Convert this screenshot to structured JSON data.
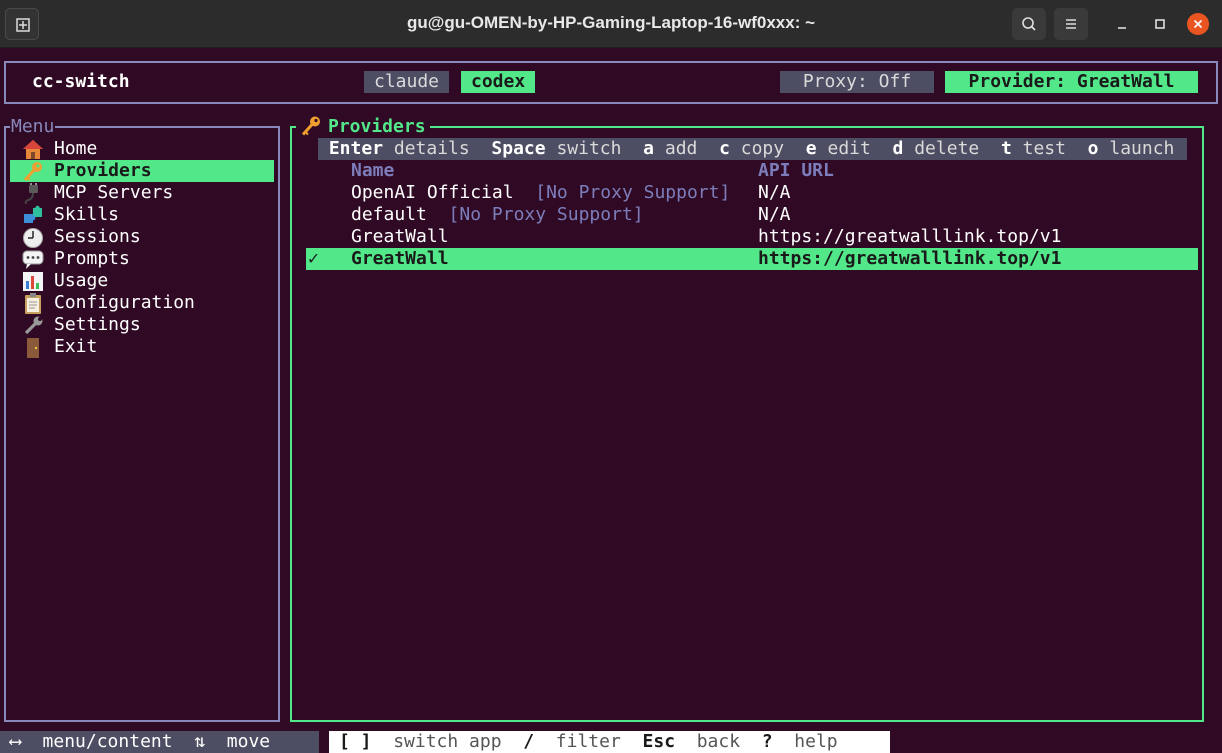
{
  "window": {
    "title": "gu@gu-OMEN-by-HP-Gaming-Laptop-16-wf0xxx: ~"
  },
  "header": {
    "app_name": "cc-switch",
    "tabs": [
      {
        "label": "claude",
        "active": false
      },
      {
        "label": "codex",
        "active": true
      }
    ],
    "proxy_status": "Proxy: Off",
    "provider_status": "Provider: GreatWall"
  },
  "menu": {
    "title": "Menu",
    "items": [
      {
        "label": "Home",
        "icon": "house-icon",
        "active": false
      },
      {
        "label": "Providers",
        "icon": "key-icon",
        "active": true
      },
      {
        "label": "MCP Servers",
        "icon": "plug-icon",
        "active": false
      },
      {
        "label": "Skills",
        "icon": "puzzle-icon",
        "active": false
      },
      {
        "label": "Sessions",
        "icon": "clock-icon",
        "active": false
      },
      {
        "label": "Prompts",
        "icon": "speech-bubble-icon",
        "active": false
      },
      {
        "label": "Usage",
        "icon": "bar-chart-icon",
        "active": false
      },
      {
        "label": "Configuration",
        "icon": "clipboard-icon",
        "active": false
      },
      {
        "label": "Settings",
        "icon": "wrench-icon",
        "active": false
      },
      {
        "label": "Exit",
        "icon": "door-icon",
        "active": false
      }
    ]
  },
  "providers": {
    "title": "Providers",
    "keybindings": [
      {
        "key": "Enter",
        "action": "details"
      },
      {
        "key": "Space",
        "action": "switch"
      },
      {
        "key": "a",
        "action": "add"
      },
      {
        "key": "c",
        "action": "copy"
      },
      {
        "key": "e",
        "action": "edit"
      },
      {
        "key": "d",
        "action": "delete"
      },
      {
        "key": "t",
        "action": "test"
      },
      {
        "key": "o",
        "action": "launch"
      }
    ],
    "columns": {
      "name": "Name",
      "url": "API URL"
    },
    "rows": [
      {
        "check": "",
        "name": "OpenAI Official",
        "note": "[No Proxy Support]",
        "url": "N/A",
        "selected": false
      },
      {
        "check": "",
        "name": "default",
        "note": "[No Proxy Support]",
        "url": "N/A",
        "selected": false
      },
      {
        "check": "",
        "name": "GreatWall",
        "note": "",
        "url": "https://greatwalllink.top/v1",
        "selected": false
      },
      {
        "check": "✓",
        "name": "GreatWall",
        "note": "",
        "url": "https://greatwalllink.top/v1",
        "selected": true
      }
    ]
  },
  "footer": {
    "left": [
      {
        "key": "⟷",
        "action": "menu/content"
      },
      {
        "key": "⇅",
        "action": "move"
      }
    ],
    "right": [
      {
        "key": "[ ]",
        "action": "switch app"
      },
      {
        "key": "/",
        "action": "filter"
      },
      {
        "key": "Esc",
        "action": "back"
      },
      {
        "key": "?",
        "action": "help"
      }
    ]
  },
  "colors": {
    "background": "#300a24",
    "accent": "#52e88a",
    "panel_border": "#8888bb",
    "muted_bar": "#4d4d63",
    "header_text": "#7d7dbb"
  }
}
